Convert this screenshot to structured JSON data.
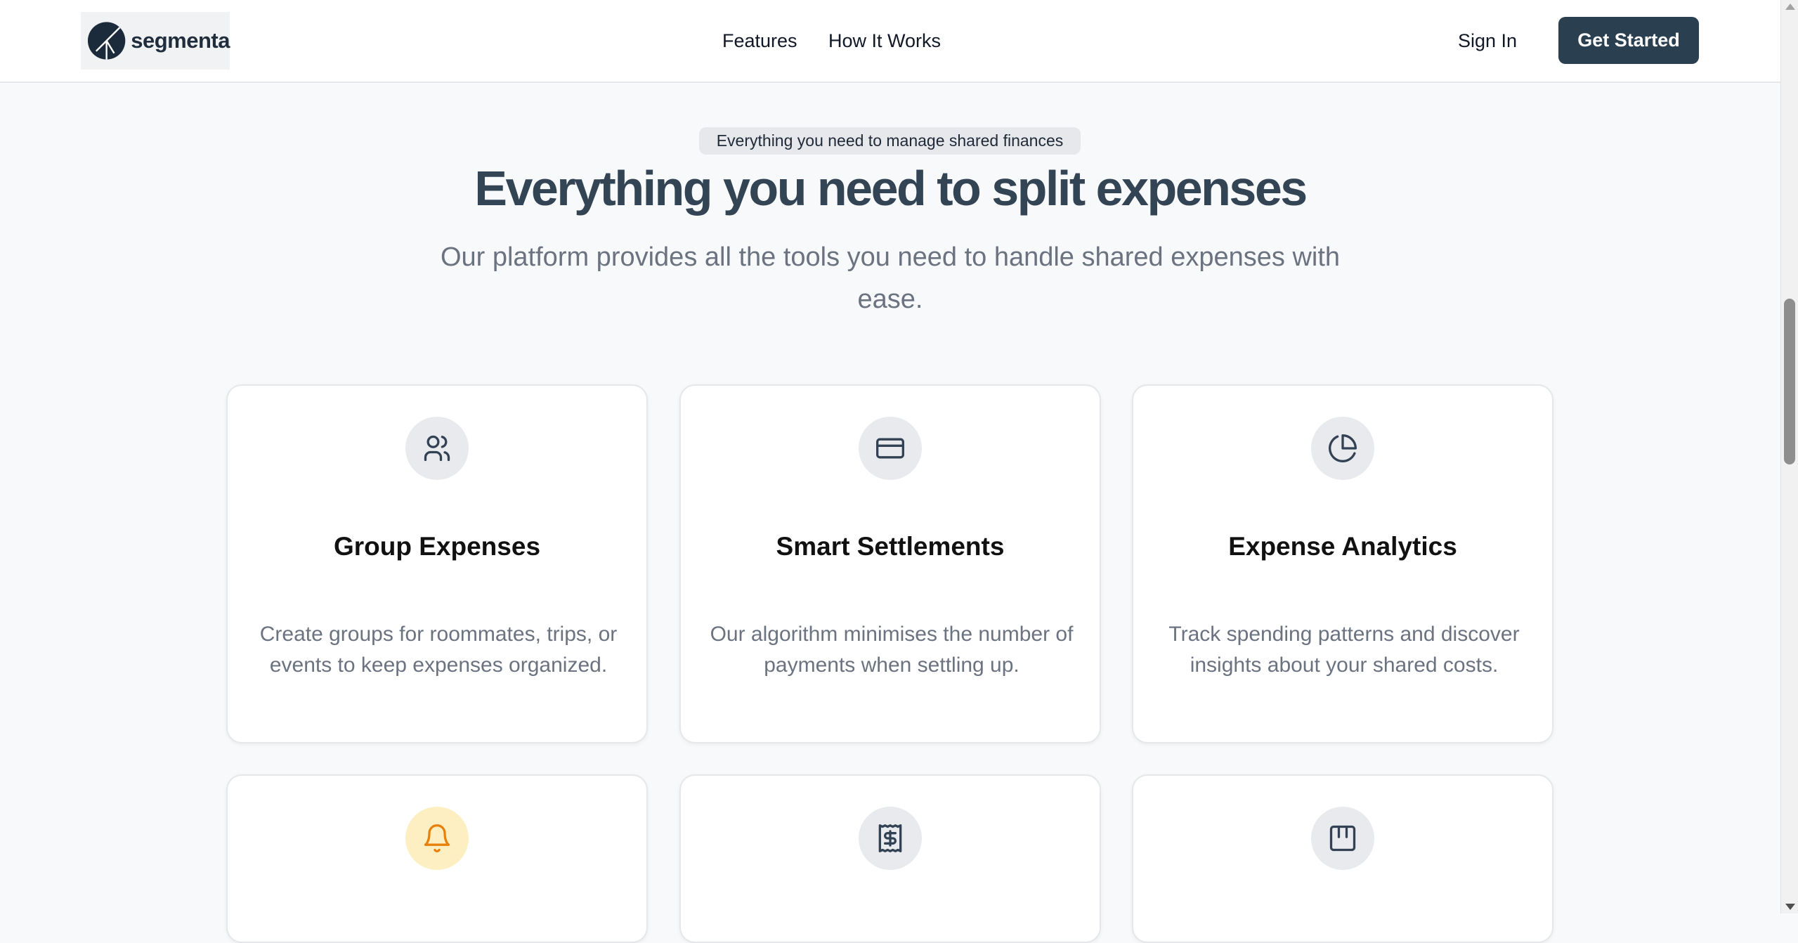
{
  "header": {
    "logo_text": "segmenta",
    "nav": [
      {
        "label": "Features"
      },
      {
        "label": "How It Works"
      }
    ],
    "sign_in_label": "Sign In",
    "cta_label": "Get Started"
  },
  "hero": {
    "badge": "Everything you need to manage shared finances",
    "title": "Everything you need to split expenses",
    "subtitle": "Our platform provides all the tools you need to handle shared expenses with ease."
  },
  "features": [
    {
      "icon": "users-icon",
      "title": "Group Expenses",
      "description": "Create groups for roommates, trips, or events to keep expenses organized."
    },
    {
      "icon": "credit-card-icon",
      "title": "Smart Settlements",
      "description": "Our algorithm minimises the number of payments when settling up."
    },
    {
      "icon": "pie-chart-icon",
      "title": "Expense Analytics",
      "description": "Track spending patterns and discover insights about your shared costs."
    },
    {
      "icon": "bell-icon",
      "icon_color": "#e8810c"
    },
    {
      "icon": "receipt-icon"
    },
    {
      "icon": "calendar-grid-icon"
    }
  ],
  "colors": {
    "brand_dark": "#2a3f50",
    "title_color": "#334455",
    "muted_text": "#6b7280",
    "icon_bg": "#e8eaed",
    "warning_bg": "#fdefc2",
    "warning_icon": "#e8810c"
  }
}
